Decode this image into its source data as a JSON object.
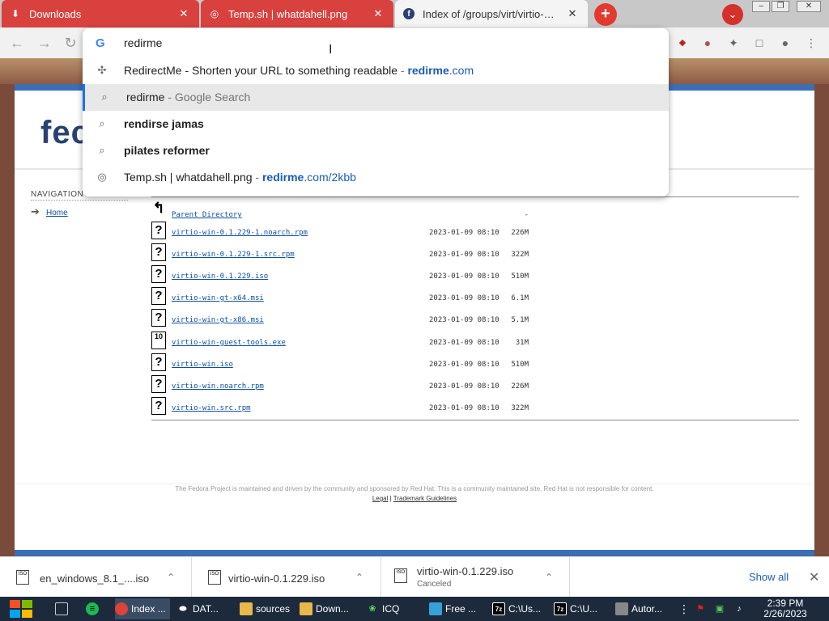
{
  "tabs": [
    {
      "label": "Downloads",
      "icon": "download-icon"
    },
    {
      "label": "Temp.sh | whatdahell.png",
      "icon": "globe-icon"
    },
    {
      "label": "Index of /groups/virt/virtio-win/d",
      "icon": "fedora-icon"
    }
  ],
  "omnibox": {
    "input": "redirme",
    "suggestions": [
      {
        "main": "RedirectMe - Shorten your URL to something readable",
        "sep": " - ",
        "url_bold": "redirme",
        "url_rest": ".com",
        "icon": "site-icon"
      },
      {
        "main": "redirme",
        "sep": " - ",
        "rest": "Google Search",
        "icon": "search-icon"
      },
      {
        "main": "rendirse jamas",
        "icon": "search-icon"
      },
      {
        "main": "pilates reformer",
        "icon": "search-icon"
      },
      {
        "main": "Temp.sh | whatdahell.png",
        "sep": " - ",
        "url_bold": "redirme",
        "url_rest": ".com/2kbb",
        "icon": "globe-icon"
      }
    ]
  },
  "page": {
    "logo": "fec",
    "nav_heading": "NAVIGATION",
    "nav_home": "Home",
    "files": [
      {
        "name": "Parent Directory",
        "date": "",
        "size": "-",
        "icon": "?"
      },
      {
        "name": "virtio-win-0.1.229-1.noarch.rpm",
        "date": "2023-01-09 08:10",
        "size": "226M",
        "icon": "?"
      },
      {
        "name": "virtio-win-0.1.229-1.src.rpm",
        "date": "2023-01-09 08:10",
        "size": "322M",
        "icon": "?"
      },
      {
        "name": "virtio-win-0.1.229.iso",
        "date": "2023-01-09 08:10",
        "size": "510M",
        "icon": "?"
      },
      {
        "name": "virtio-win-gt-x64.msi",
        "date": "2023-01-09 08:10",
        "size": "6.1M",
        "icon": "?"
      },
      {
        "name": "virtio-win-gt-x86.msi",
        "date": "2023-01-09 08:10",
        "size": "5.1M",
        "icon": "?"
      },
      {
        "name": "virtio-win-guest-tools.exe",
        "date": "2023-01-09 08:10",
        "size": "31M",
        "icon": "10"
      },
      {
        "name": "virtio-win.iso",
        "date": "2023-01-09 08:10",
        "size": "510M",
        "icon": "?"
      },
      {
        "name": "virtio-win.noarch.rpm",
        "date": "2023-01-09 08:10",
        "size": "226M",
        "icon": "?"
      },
      {
        "name": "virtio-win.src.rpm",
        "date": "2023-01-09 08:10",
        "size": "322M",
        "icon": "?"
      }
    ],
    "footer_text": "The Fedora Project is maintained and driven by the community and sponsored by Red Hat. This is a community maintained site. Red Hat is not responsible for content.",
    "footer_link1": "Legal",
    "footer_sep": " | ",
    "footer_link2": "Trademark Guidelines"
  },
  "downloads": [
    {
      "name": "en_windows_8.1_....iso",
      "status": ""
    },
    {
      "name": "virtio-win-0.1.229.iso",
      "status": ""
    },
    {
      "name": "virtio-win-0.1.229.iso",
      "status": "Canceled"
    }
  ],
  "show_all": "Show all",
  "taskbar": {
    "items": [
      {
        "label": "",
        "icon": "desktop-icon"
      },
      {
        "label": "",
        "icon": "spotify-icon"
      },
      {
        "label": "Index ...",
        "icon": "chrome-icon"
      },
      {
        "label": "DAT...",
        "icon": "drive-icon"
      },
      {
        "label": "sources",
        "icon": "folder-icon"
      },
      {
        "label": "Down...",
        "icon": "folder-icon"
      },
      {
        "label": "ICQ",
        "icon": "icq-icon"
      },
      {
        "label": "Free ...",
        "icon": "app-icon"
      },
      {
        "label": "C:\\Us...",
        "icon": "7zip-icon"
      },
      {
        "label": "C:\\U...",
        "icon": "7zip-icon"
      },
      {
        "label": "Autor...",
        "icon": "app-icon"
      }
    ],
    "time": "2:39 PM",
    "date": "2/26/2023"
  }
}
